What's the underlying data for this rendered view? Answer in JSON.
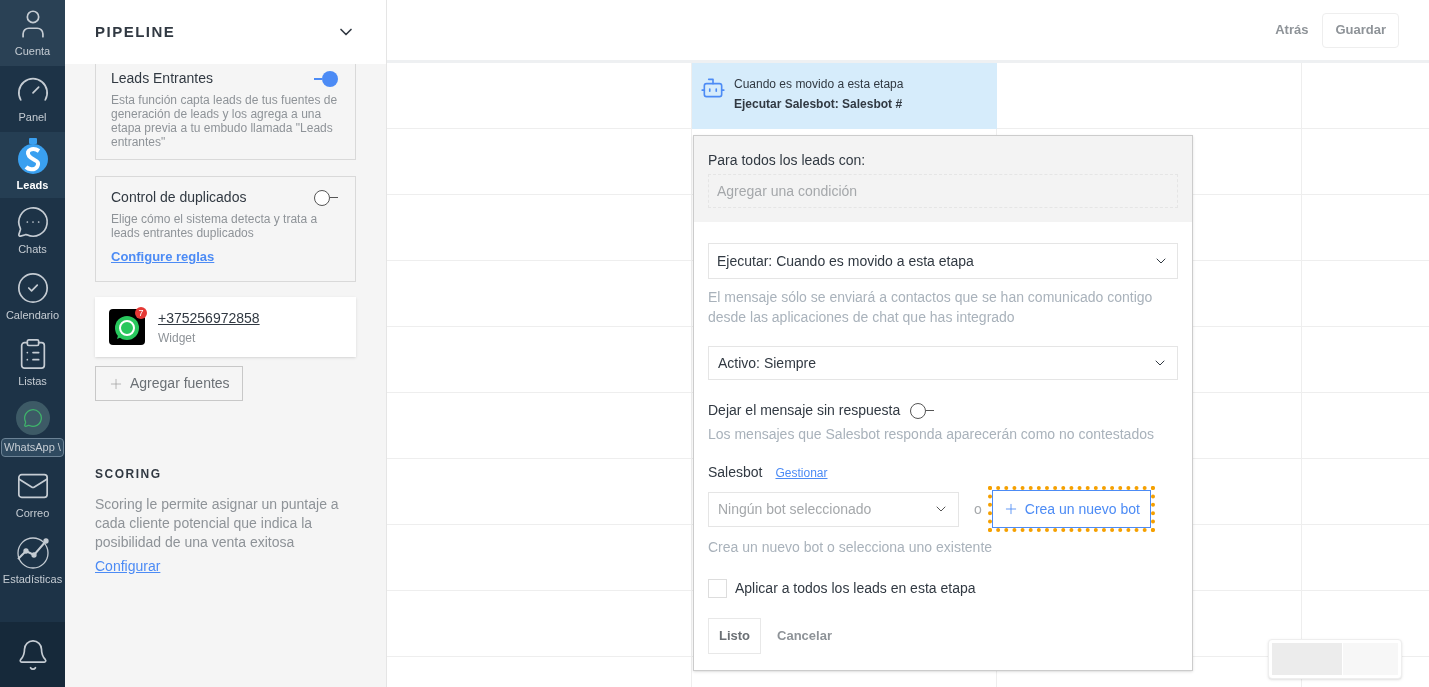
{
  "nav": [
    {
      "kind": "account",
      "label": "Cuenta",
      "selected": false
    },
    {
      "kind": "panel",
      "label": "Panel",
      "selected": false
    },
    {
      "kind": "leads",
      "label": "Leads",
      "selected": true
    },
    {
      "kind": "chats",
      "label": "Chats",
      "selected": false
    },
    {
      "kind": "calendar",
      "label": "Calendario",
      "selected": false
    },
    {
      "kind": "lists",
      "label": "Listas",
      "selected": false
    },
    {
      "kind": "whatsapp",
      "label": "WhatsApp \\",
      "selected": false
    },
    {
      "kind": "mail",
      "label": "Correo",
      "selected": false
    },
    {
      "kind": "stats",
      "label": "Estadísticas",
      "selected": false
    },
    {
      "kind": "bell",
      "selected": false
    }
  ],
  "pipeline": {
    "title": "PIPELINE",
    "cards": [
      {
        "title": "Leads Entrantes",
        "on": true,
        "description": "Esta función capta leads de tus fuentes de generación de leads y los agrega a una etapa previa a tu embudo llamada \"Leads entrantes\""
      },
      {
        "title": "Control de duplicados",
        "on": false,
        "description": "Elige cómo el sistema detecta y trata a leads entrantes duplicados",
        "link": "Configure reglas"
      }
    ],
    "source": {
      "phone": "+375256972858",
      "subtitle": "Widget",
      "badge": "7"
    },
    "add_button": "Agregar fuentes",
    "scoring": {
      "title": "SCORING",
      "description": "Scoring le permite asignar un puntaje a cada cliente potencial que indica la posibilidad de una venta exitosa",
      "link": "Configurar"
    }
  },
  "header": {
    "back": "Atrás",
    "save": "Guardar"
  },
  "stage_card": {
    "trigger": "Cuando es movido a esta etapa",
    "action": "Ejecutar Salesbot: Salesbot #"
  },
  "popup": {
    "condition_label": "Para todos los leads con:",
    "condition_placeholder": "Agregar una condición",
    "execute_select": "Ejecutar: Cuando es movido a esta etapa",
    "execute_hint": "El mensaje sólo se enviará a contactos que se han comunicado contigo desde las aplicaciones de chat que has integrado",
    "active_select": "Activo: Siempre",
    "unanswered": {
      "label": "Dejar el mensaje sin respuesta",
      "on": false,
      "hint": "Los mensajes que Salesbot responda aparecerán como no contestados"
    },
    "salesbot_label": "Salesbot",
    "manage_link": "Gestionar",
    "bot_select_placeholder": "Ningún bot seleccionado",
    "or": "o",
    "create_button": "Crea un nuevo bot",
    "bot_hint": "Crea un nuevo bot o selecciona uno existente",
    "apply_all": {
      "label": "Aplicar a todos los leads en esta etapa",
      "checked": false
    },
    "done": "Listo",
    "cancel": "Cancelar"
  }
}
